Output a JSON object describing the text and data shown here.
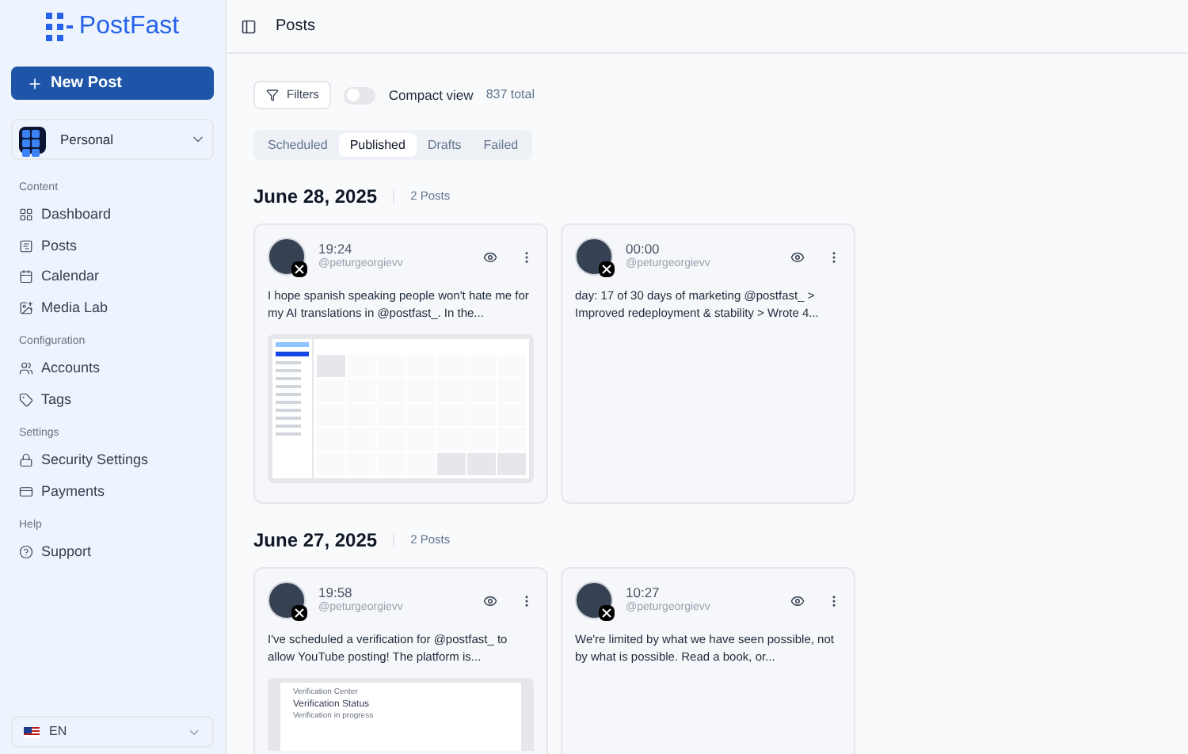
{
  "sidebar": {
    "logo": "PostFast",
    "new_post_button": "New Post",
    "workspace": {
      "name": "Personal"
    },
    "sections": [
      {
        "title": "Content",
        "items": [
          {
            "label": "Dashboard",
            "kind": "grid",
            "selected": false
          },
          {
            "label": "Posts",
            "kind": "posts",
            "selected": false
          },
          {
            "label": "Calendar",
            "kind": "calendar",
            "selected": false
          },
          {
            "label": "Media Lab",
            "kind": "media",
            "selected": false
          }
        ]
      },
      {
        "title": "Configuration",
        "items": [
          {
            "label": "Accounts",
            "kind": "users",
            "selected": false
          },
          {
            "label": "Tags",
            "kind": "tag",
            "selected": false
          }
        ]
      },
      {
        "title": "Settings",
        "items": [
          {
            "label": "Security Settings",
            "kind": "lock",
            "selected": false
          },
          {
            "label": "Payments",
            "kind": "card",
            "selected": false
          }
        ]
      },
      {
        "title": "Help",
        "items": [
          {
            "label": "Support",
            "kind": "help",
            "selected": false
          }
        ]
      }
    ],
    "language": "EN"
  },
  "header": {
    "title": "Posts"
  },
  "toolbar": {
    "filters_button": "Filters",
    "compact_view": {
      "label": "Compact view",
      "on": false
    },
    "total": "837 total"
  },
  "tabs": [
    {
      "label": "Scheduled",
      "selected": false
    },
    {
      "label": "Published",
      "selected": true
    },
    {
      "label": "Drafts",
      "selected": false
    },
    {
      "label": "Failed",
      "selected": false
    }
  ],
  "groups": [
    {
      "date": "June 28, 2025",
      "count": "2 Posts",
      "posts": [
        {
          "time": "19:24",
          "handle": "@peturgeorgievv",
          "text": "I hope spanish speaking people won't hate me for my AI translations in @postfast_. In the...",
          "media": {
            "kind": "calendar"
          }
        },
        {
          "time": "00:00",
          "handle": "@peturgeorgievv",
          "text": "day: 17 of 30 days of marketing @postfast_ > Improved redeployment & stability > Wrote 4..."
        }
      ]
    },
    {
      "date": "June 27, 2025",
      "count": "2 Posts",
      "posts": [
        {
          "time": "19:58",
          "handle": "@peturgeorgievv",
          "text": "I've scheduled a verification for @postfast_ to allow YouTube posting! The platform is...",
          "media": {
            "kind": "verification",
            "lines": [
              "Verification Center",
              "Verification Status",
              "Verification in progress"
            ]
          }
        },
        {
          "time": "10:27",
          "handle": "@peturgeorgievv",
          "text": "We're limited by what we have seen possible, not by what is possible. Read a book, or..."
        }
      ]
    }
  ]
}
